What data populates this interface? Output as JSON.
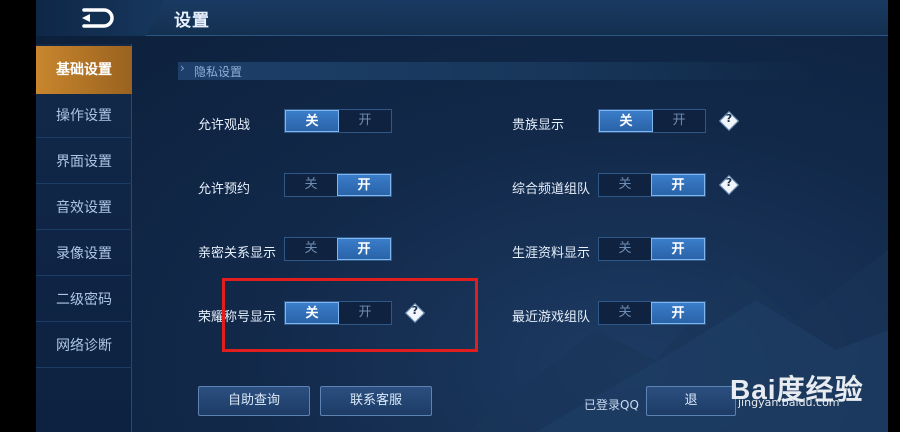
{
  "header": {
    "title": "设置"
  },
  "sidebar": {
    "items": [
      {
        "label": "基础设置",
        "active": true
      },
      {
        "label": "操作设置",
        "active": false
      },
      {
        "label": "界面设置",
        "active": false
      },
      {
        "label": "音效设置",
        "active": false
      },
      {
        "label": "录像设置",
        "active": false
      },
      {
        "label": "二级密码",
        "active": false
      },
      {
        "label": "网络诊断",
        "active": false
      }
    ]
  },
  "section": {
    "title": "隐私设置"
  },
  "toggle_labels": {
    "off": "关",
    "on": "开"
  },
  "settings": [
    {
      "label": "允许观战",
      "value": "关",
      "help": false
    },
    {
      "label": "允许预约",
      "value": "开",
      "help": false
    },
    {
      "label": "亲密关系显示",
      "value": "开",
      "help": false
    },
    {
      "label": "荣耀称号显示",
      "value": "关",
      "help": true
    },
    {
      "label": "贵族显示",
      "value": "关",
      "help": true
    },
    {
      "label": "综合频道组队",
      "value": "开",
      "help": true
    },
    {
      "label": "生涯资料显示",
      "value": "开",
      "help": false
    },
    {
      "label": "最近游戏组队",
      "value": "开",
      "help": false
    }
  ],
  "help_glyph": "?",
  "footer": {
    "self_query": "自助查询",
    "contact_service": "联系客服",
    "logged_in": "已登录QQ",
    "logout_partial": "退"
  },
  "watermark": {
    "logo": "Bai度经验",
    "url": "jingyan.baidu.com"
  },
  "colors": {
    "accent": "#c8862d",
    "toggle_on": "#2a63a8",
    "highlight": "#e01e1e"
  }
}
